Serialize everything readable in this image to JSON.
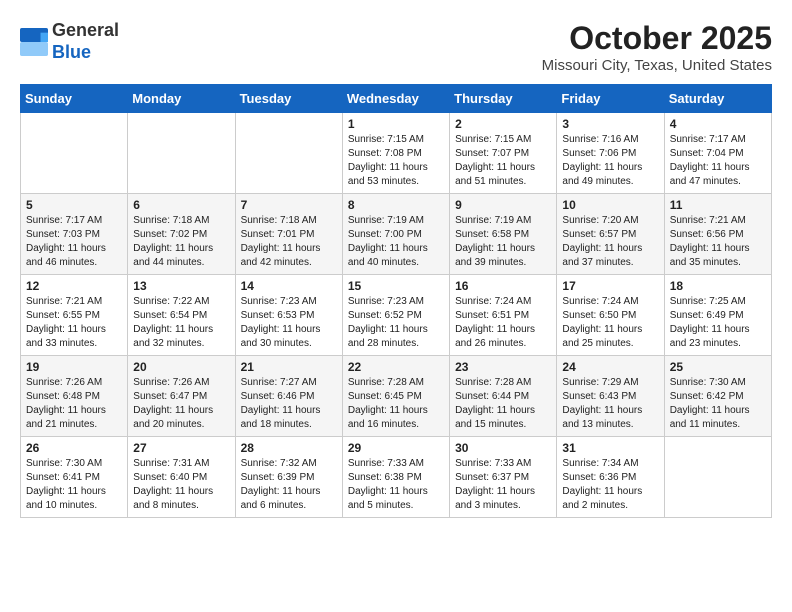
{
  "header": {
    "logo_general": "General",
    "logo_blue": "Blue",
    "month": "October 2025",
    "location": "Missouri City, Texas, United States"
  },
  "days_of_week": [
    "Sunday",
    "Monday",
    "Tuesday",
    "Wednesday",
    "Thursday",
    "Friday",
    "Saturday"
  ],
  "weeks": [
    [
      {
        "day": "",
        "info": ""
      },
      {
        "day": "",
        "info": ""
      },
      {
        "day": "",
        "info": ""
      },
      {
        "day": "1",
        "info": "Sunrise: 7:15 AM\nSunset: 7:08 PM\nDaylight: 11 hours and 53 minutes."
      },
      {
        "day": "2",
        "info": "Sunrise: 7:15 AM\nSunset: 7:07 PM\nDaylight: 11 hours and 51 minutes."
      },
      {
        "day": "3",
        "info": "Sunrise: 7:16 AM\nSunset: 7:06 PM\nDaylight: 11 hours and 49 minutes."
      },
      {
        "day": "4",
        "info": "Sunrise: 7:17 AM\nSunset: 7:04 PM\nDaylight: 11 hours and 47 minutes."
      }
    ],
    [
      {
        "day": "5",
        "info": "Sunrise: 7:17 AM\nSunset: 7:03 PM\nDaylight: 11 hours and 46 minutes."
      },
      {
        "day": "6",
        "info": "Sunrise: 7:18 AM\nSunset: 7:02 PM\nDaylight: 11 hours and 44 minutes."
      },
      {
        "day": "7",
        "info": "Sunrise: 7:18 AM\nSunset: 7:01 PM\nDaylight: 11 hours and 42 minutes."
      },
      {
        "day": "8",
        "info": "Sunrise: 7:19 AM\nSunset: 7:00 PM\nDaylight: 11 hours and 40 minutes."
      },
      {
        "day": "9",
        "info": "Sunrise: 7:19 AM\nSunset: 6:58 PM\nDaylight: 11 hours and 39 minutes."
      },
      {
        "day": "10",
        "info": "Sunrise: 7:20 AM\nSunset: 6:57 PM\nDaylight: 11 hours and 37 minutes."
      },
      {
        "day": "11",
        "info": "Sunrise: 7:21 AM\nSunset: 6:56 PM\nDaylight: 11 hours and 35 minutes."
      }
    ],
    [
      {
        "day": "12",
        "info": "Sunrise: 7:21 AM\nSunset: 6:55 PM\nDaylight: 11 hours and 33 minutes."
      },
      {
        "day": "13",
        "info": "Sunrise: 7:22 AM\nSunset: 6:54 PM\nDaylight: 11 hours and 32 minutes."
      },
      {
        "day": "14",
        "info": "Sunrise: 7:23 AM\nSunset: 6:53 PM\nDaylight: 11 hours and 30 minutes."
      },
      {
        "day": "15",
        "info": "Sunrise: 7:23 AM\nSunset: 6:52 PM\nDaylight: 11 hours and 28 minutes."
      },
      {
        "day": "16",
        "info": "Sunrise: 7:24 AM\nSunset: 6:51 PM\nDaylight: 11 hours and 26 minutes."
      },
      {
        "day": "17",
        "info": "Sunrise: 7:24 AM\nSunset: 6:50 PM\nDaylight: 11 hours and 25 minutes."
      },
      {
        "day": "18",
        "info": "Sunrise: 7:25 AM\nSunset: 6:49 PM\nDaylight: 11 hours and 23 minutes."
      }
    ],
    [
      {
        "day": "19",
        "info": "Sunrise: 7:26 AM\nSunset: 6:48 PM\nDaylight: 11 hours and 21 minutes."
      },
      {
        "day": "20",
        "info": "Sunrise: 7:26 AM\nSunset: 6:47 PM\nDaylight: 11 hours and 20 minutes."
      },
      {
        "day": "21",
        "info": "Sunrise: 7:27 AM\nSunset: 6:46 PM\nDaylight: 11 hours and 18 minutes."
      },
      {
        "day": "22",
        "info": "Sunrise: 7:28 AM\nSunset: 6:45 PM\nDaylight: 11 hours and 16 minutes."
      },
      {
        "day": "23",
        "info": "Sunrise: 7:28 AM\nSunset: 6:44 PM\nDaylight: 11 hours and 15 minutes."
      },
      {
        "day": "24",
        "info": "Sunrise: 7:29 AM\nSunset: 6:43 PM\nDaylight: 11 hours and 13 minutes."
      },
      {
        "day": "25",
        "info": "Sunrise: 7:30 AM\nSunset: 6:42 PM\nDaylight: 11 hours and 11 minutes."
      }
    ],
    [
      {
        "day": "26",
        "info": "Sunrise: 7:30 AM\nSunset: 6:41 PM\nDaylight: 11 hours and 10 minutes."
      },
      {
        "day": "27",
        "info": "Sunrise: 7:31 AM\nSunset: 6:40 PM\nDaylight: 11 hours and 8 minutes."
      },
      {
        "day": "28",
        "info": "Sunrise: 7:32 AM\nSunset: 6:39 PM\nDaylight: 11 hours and 6 minutes."
      },
      {
        "day": "29",
        "info": "Sunrise: 7:33 AM\nSunset: 6:38 PM\nDaylight: 11 hours and 5 minutes."
      },
      {
        "day": "30",
        "info": "Sunrise: 7:33 AM\nSunset: 6:37 PM\nDaylight: 11 hours and 3 minutes."
      },
      {
        "day": "31",
        "info": "Sunrise: 7:34 AM\nSunset: 6:36 PM\nDaylight: 11 hours and 2 minutes."
      },
      {
        "day": "",
        "info": ""
      }
    ]
  ]
}
